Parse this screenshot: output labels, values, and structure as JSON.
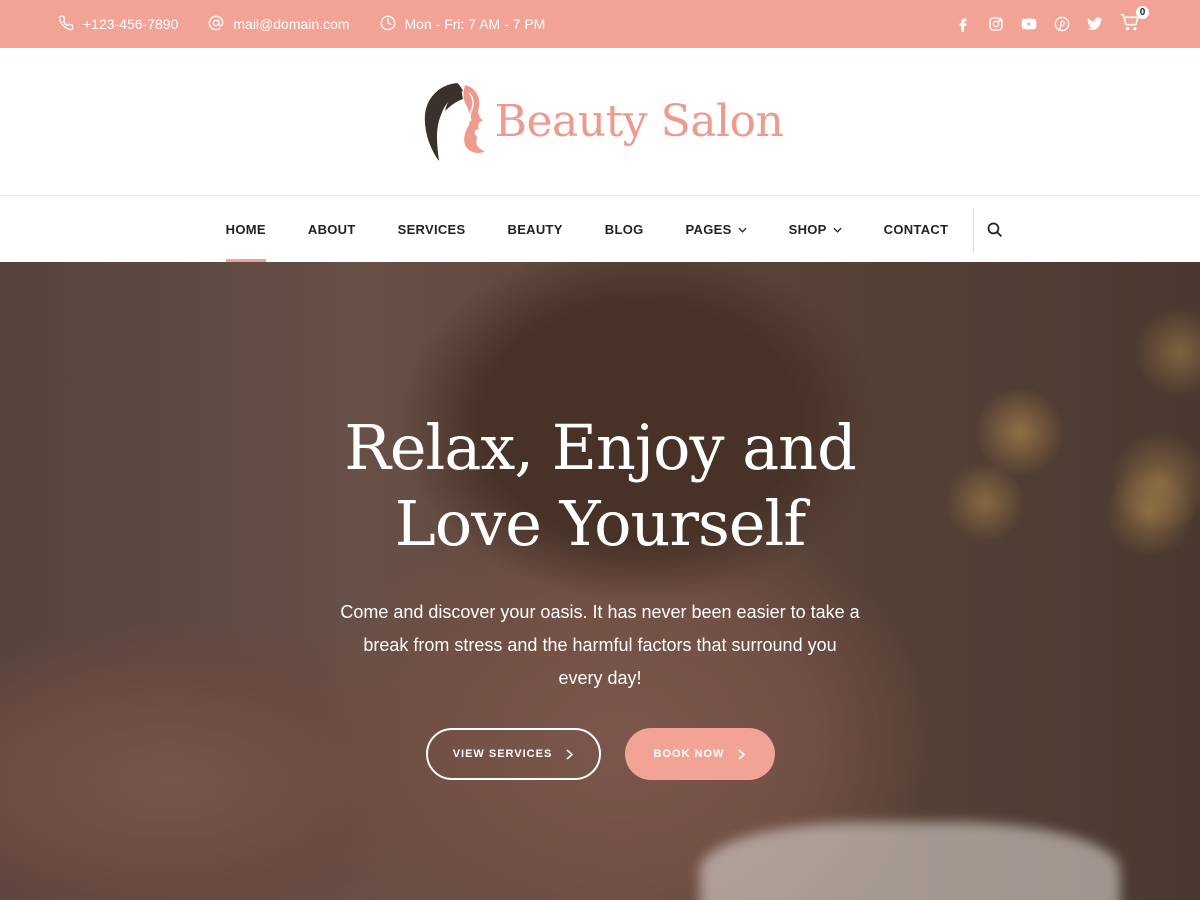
{
  "topbar": {
    "phone": "+123-456-7890",
    "email": "mail@domain.com",
    "hours": "Mon - Fri: 7 AM - 7 PM",
    "socials": [
      "facebook-icon",
      "instagram-icon",
      "youtube-icon",
      "pinterest-icon",
      "twitter-icon"
    ],
    "cart_count": "0",
    "background": "#f2a396"
  },
  "brand": {
    "name": "Beauty Salon",
    "color": "#ee9a8d"
  },
  "nav": {
    "items": [
      {
        "label": "HOME",
        "active": true
      },
      {
        "label": "ABOUT"
      },
      {
        "label": "SERVICES"
      },
      {
        "label": "BEAUTY"
      },
      {
        "label": "BLOG"
      },
      {
        "label": "PAGES",
        "dropdown": true
      },
      {
        "label": "SHOP",
        "dropdown": true
      },
      {
        "label": "CONTACT"
      }
    ]
  },
  "hero": {
    "title": "Relax, Enjoy and Love Yourself",
    "subtitle": "Come and discover your oasis. It has never been easier to take a break from stress and the harmful factors that surround you every day!",
    "primary_button": "VIEW SERVICES",
    "secondary_button": "BOOK NOW"
  }
}
